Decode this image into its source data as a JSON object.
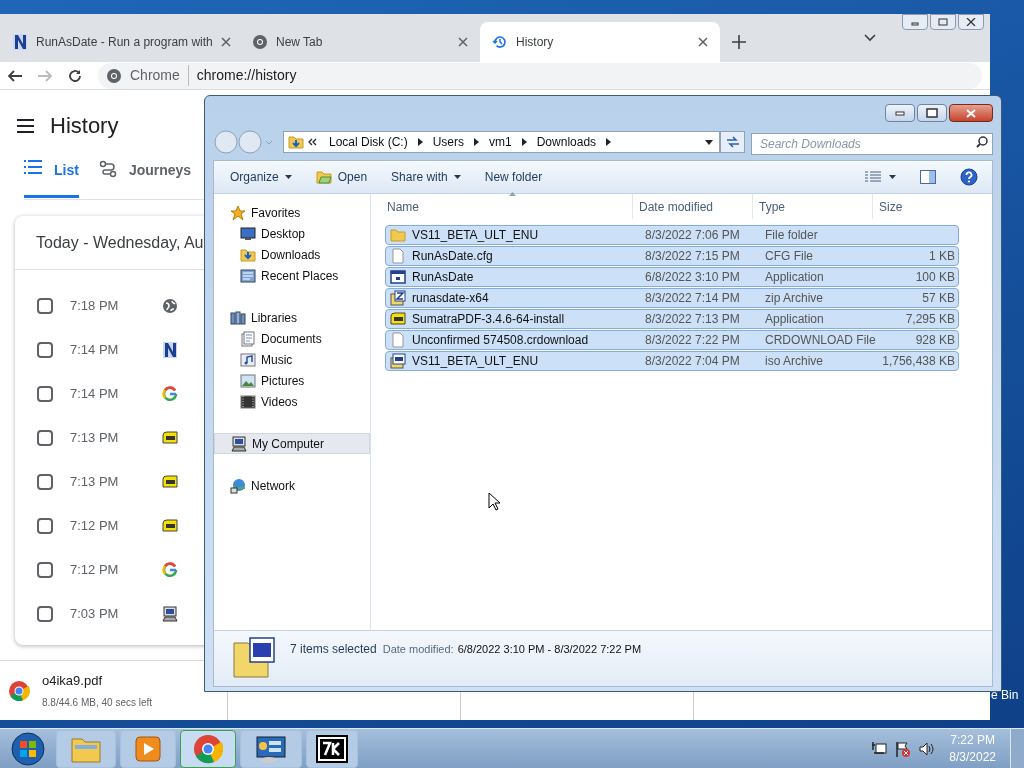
{
  "chrome": {
    "tabs": [
      {
        "title": "RunAsDate - Run a program with",
        "kind": "n",
        "selected": false
      },
      {
        "title": "New Tab",
        "kind": "chrome",
        "selected": false
      },
      {
        "title": "History",
        "kind": "history",
        "selected": true
      }
    ],
    "omnibox": {
      "chip": "Chrome",
      "url": "chrome://history"
    },
    "page_title": "History",
    "view_tabs": [
      {
        "label": "List",
        "kind": "list",
        "selected": true
      },
      {
        "label": "Journeys",
        "kind": "journeys",
        "selected": false
      }
    ],
    "day_heading": "Today - Wednesday, Au",
    "entries": [
      {
        "time": "7:18 PM",
        "kind": "globe",
        "checked": false
      },
      {
        "time": "7:14 PM",
        "kind": "n",
        "checked": false
      },
      {
        "time": "7:14 PM",
        "kind": "google",
        "checked": false
      },
      {
        "time": "7:13 PM",
        "kind": "pdf",
        "checked": false
      },
      {
        "time": "7:13 PM",
        "kind": "pdf",
        "checked": false
      },
      {
        "time": "7:12 PM",
        "kind": "pdf",
        "checked": false
      },
      {
        "time": "7:12 PM",
        "kind": "google",
        "checked": false
      },
      {
        "time": "7:03 PM",
        "kind": "computer",
        "checked": false
      }
    ],
    "download": {
      "filename": "o4ika9.pdf",
      "status": "8.8/44.6 MB, 40 secs left"
    }
  },
  "desktop_label": "e Bin",
  "explorer": {
    "breadcrumb": [
      "Local Disk (C:)",
      "Users",
      "vm1",
      "Downloads"
    ],
    "search": {
      "placeholder": "Search Downloads"
    },
    "toolbar": [
      {
        "label": "Organize",
        "kind": "menu"
      },
      {
        "label": "Open",
        "kind": "open"
      },
      {
        "label": "Share with",
        "kind": "menu"
      },
      {
        "label": "New folder",
        "kind": "plain"
      }
    ],
    "nav": [
      {
        "label": "Favorites",
        "kind": "star",
        "selected": false,
        "children": [
          {
            "label": "Desktop",
            "kind": "desktop",
            "selected": false
          },
          {
            "label": "Downloads",
            "kind": "downloads",
            "selected": false
          },
          {
            "label": "Recent Places",
            "kind": "recent",
            "selected": false
          }
        ]
      },
      {
        "label": "Libraries",
        "kind": "libraries",
        "selected": false,
        "children": [
          {
            "label": "Documents",
            "kind": "documents",
            "selected": false
          },
          {
            "label": "Music",
            "kind": "music",
            "selected": false
          },
          {
            "label": "Pictures",
            "kind": "pictures",
            "selected": false
          },
          {
            "label": "Videos",
            "kind": "videos",
            "selected": false
          }
        ]
      },
      {
        "label": "My Computer",
        "kind": "computer",
        "selected": true
      },
      {
        "label": "Network",
        "kind": "network",
        "selected": false
      }
    ],
    "columns": [
      "Name",
      "Date modified",
      "Type",
      "Size"
    ],
    "files": [
      {
        "name": "VS11_BETA_ULT_ENU",
        "date": "8/3/2022 7:06 PM",
        "type": "File folder",
        "kind": "folder",
        "selected": true
      },
      {
        "name": "RunAsDate.cfg",
        "date": "8/3/2022 7:15 PM",
        "type": "CFG File",
        "size": "1 KB",
        "kind": "file",
        "selected": true
      },
      {
        "name": "RunAsDate",
        "date": "6/8/2022 3:10 PM",
        "type": "Application",
        "size": "100 KB",
        "kind": "app",
        "selected": true
      },
      {
        "name": "runasdate-x64",
        "date": "8/3/2022 7:14 PM",
        "type": "zip Archive",
        "size": "57 KB",
        "kind": "zip",
        "selected": true
      },
      {
        "name": "SumatraPDF-3.4.6-64-install",
        "date": "8/3/2022 7:13 PM",
        "type": "Application",
        "size": "7,295 KB",
        "kind": "pdf",
        "selected": true
      },
      {
        "name": "Unconfirmed 574508.crdownload",
        "date": "8/3/2022 7:22 PM",
        "type": "CRDOWNLOAD File",
        "size": "928 KB",
        "kind": "file",
        "selected": true
      },
      {
        "name": "VS11_BETA_ULT_ENU",
        "date": "8/3/2022 7:04 PM",
        "type": "iso Archive",
        "size": "1,756,438 KB",
        "kind": "iso",
        "selected": true
      }
    ],
    "details": {
      "summary": "7 items selected",
      "label": "Date modified:",
      "value": "6/8/2022 3:10 PM - 8/3/2022 7:22 PM"
    }
  },
  "taskbar": {
    "apps": [
      {
        "kind": "explorer",
        "active": false
      },
      {
        "kind": "media",
        "active": false
      },
      {
        "kind": "chrome",
        "active": true
      },
      {
        "kind": "control",
        "active": false
      },
      {
        "kind": "sevenzip",
        "active": false
      }
    ],
    "clock": {
      "time": "7:22 PM",
      "date": "8/3/2022"
    }
  }
}
